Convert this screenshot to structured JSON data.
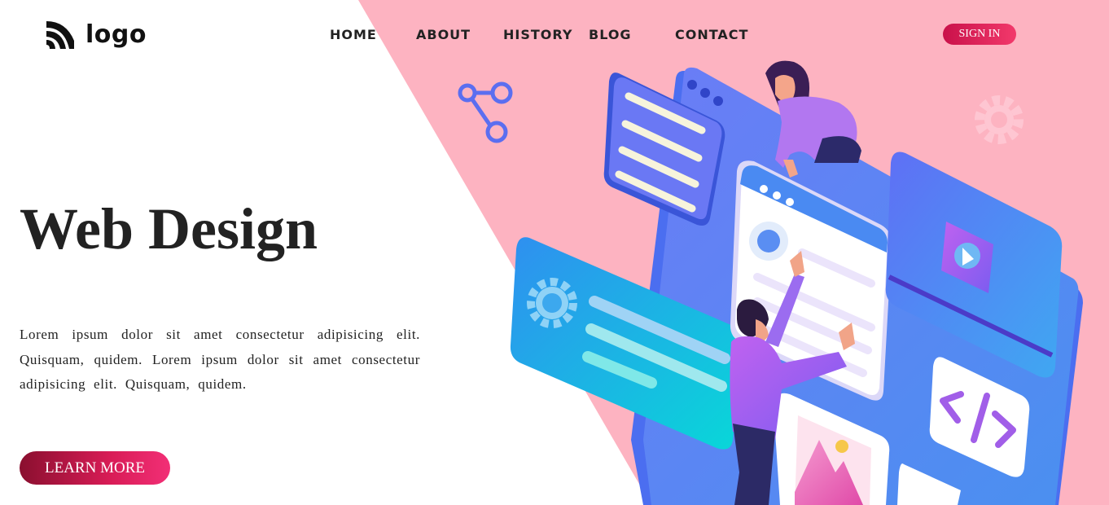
{
  "header": {
    "logo_text": "logo",
    "nav": [
      {
        "label": "HOME"
      },
      {
        "label": "ABOUT"
      },
      {
        "label": "HISTORY"
      },
      {
        "label": "BLOG"
      },
      {
        "label": "CONTACT"
      }
    ],
    "signin_label": "SIGN IN"
  },
  "hero": {
    "title": "Web Design",
    "description": "Lorem ipsum dolor sit amet consectetur adipisicing elit. Quisquam, quidem. Lorem ipsum dolor sit amet consectetur adipisicing elit. Quisquam, quidem.",
    "cta_label": "LEARN MORE"
  },
  "colors": {
    "accent": "#e8275f",
    "background_pink": "#fdb3c1",
    "illustration_blue": "#5b7ef5"
  },
  "icons": [
    "logo-icon",
    "share-icon",
    "gear-icon",
    "code-icon",
    "play-icon",
    "image-icon"
  ]
}
